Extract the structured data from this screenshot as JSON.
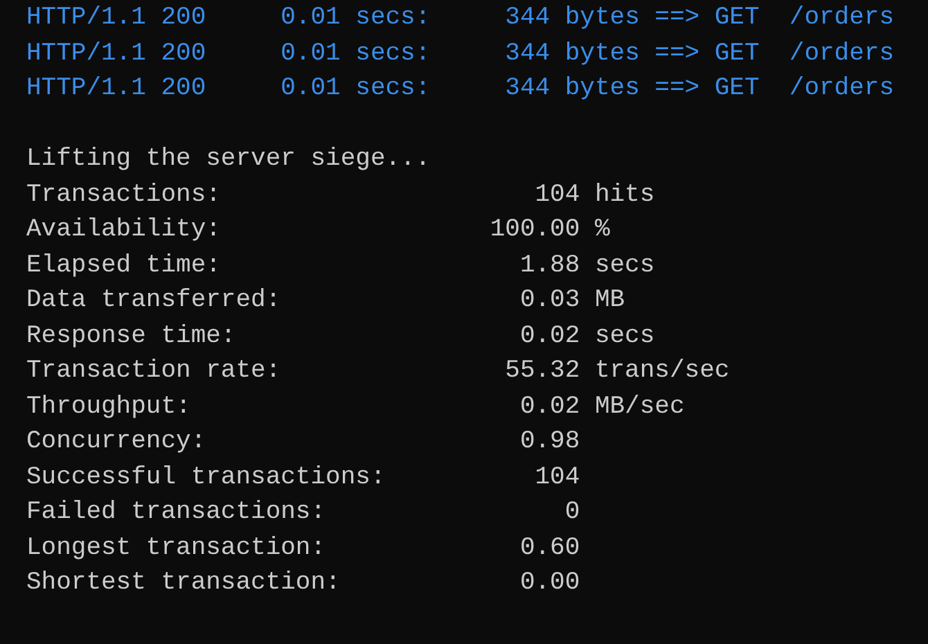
{
  "log_lines": [
    {
      "text": "HTTP/1.1 200     0.01 secs:     344 bytes ==> GET  /orders"
    },
    {
      "text": "HTTP/1.1 200     0.01 secs:     344 bytes ==> GET  /orders"
    },
    {
      "text": "HTTP/1.1 200     0.01 secs:     344 bytes ==> GET  /orders"
    }
  ],
  "message": "Lifting the server siege...",
  "stats": [
    {
      "label": "Transactions:",
      "value": "104",
      "unit": "hits"
    },
    {
      "label": "Availability:",
      "value": "100.00",
      "unit": "%"
    },
    {
      "label": "Elapsed time:",
      "value": "1.88",
      "unit": "secs"
    },
    {
      "label": "Data transferred:",
      "value": "0.03",
      "unit": "MB"
    },
    {
      "label": "Response time:",
      "value": "0.02",
      "unit": "secs"
    },
    {
      "label": "Transaction rate:",
      "value": "55.32",
      "unit": "trans/sec"
    },
    {
      "label": "Throughput:",
      "value": "0.02",
      "unit": "MB/sec"
    },
    {
      "label": "Concurrency:",
      "value": "0.98"
    },
    {
      "label": "Successful transactions:",
      "value": "104"
    },
    {
      "label": "Failed transactions:",
      "value": "0"
    },
    {
      "label": "Longest transaction:",
      "value": "0.60"
    },
    {
      "label": "Shortest transaction:",
      "value": "0.00"
    }
  ]
}
